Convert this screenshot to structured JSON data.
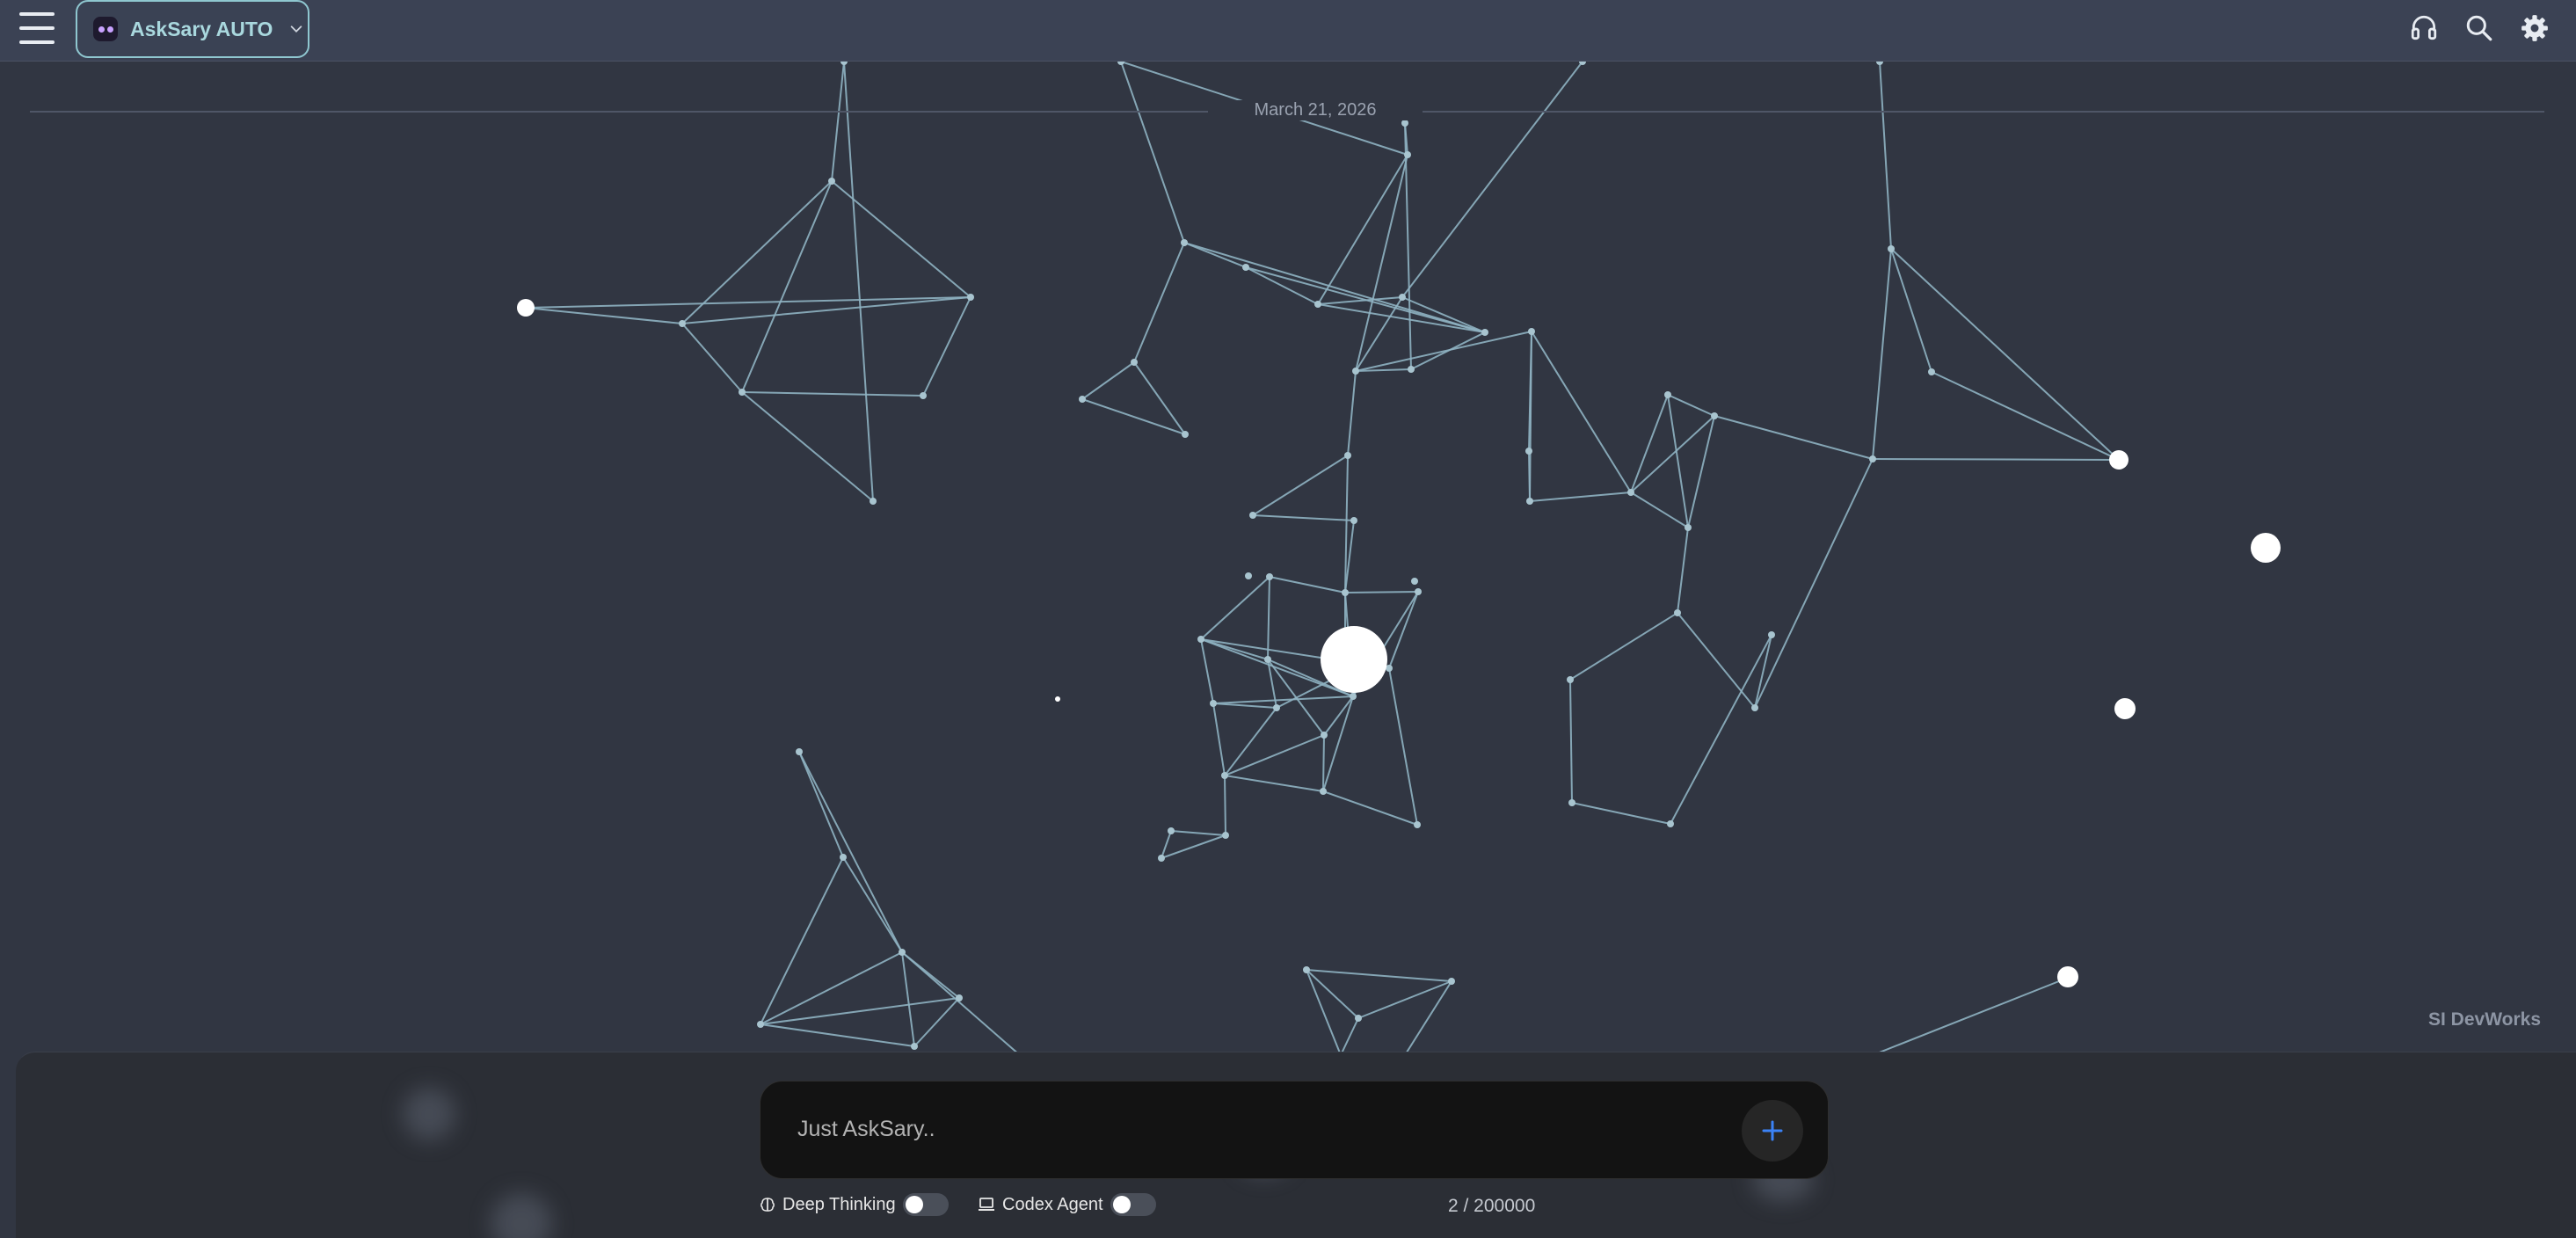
{
  "header": {
    "model_name": "AskSary AUTO",
    "icons": [
      "menu-icon",
      "headphones-icon",
      "search-icon",
      "gear-icon"
    ]
  },
  "chat": {
    "date_divider": "March 21, 2026"
  },
  "brand": {
    "watermark": "SI DevWorks"
  },
  "composer": {
    "placeholder": "Just AskSary..",
    "value": "",
    "send_icon": "plus-icon",
    "deep_thinking_label": "Deep Thinking",
    "deep_thinking_on": false,
    "codex_agent_label": "Codex Agent",
    "codex_agent_on": false,
    "char_count": "2 / 200000"
  },
  "colors": {
    "background": "#313642",
    "topbar": "#3b4254",
    "accent": "#8fc7d0",
    "network_line": "#8fb3c2",
    "input_bg": "#131313",
    "send_plus": "#3b82f6"
  }
}
